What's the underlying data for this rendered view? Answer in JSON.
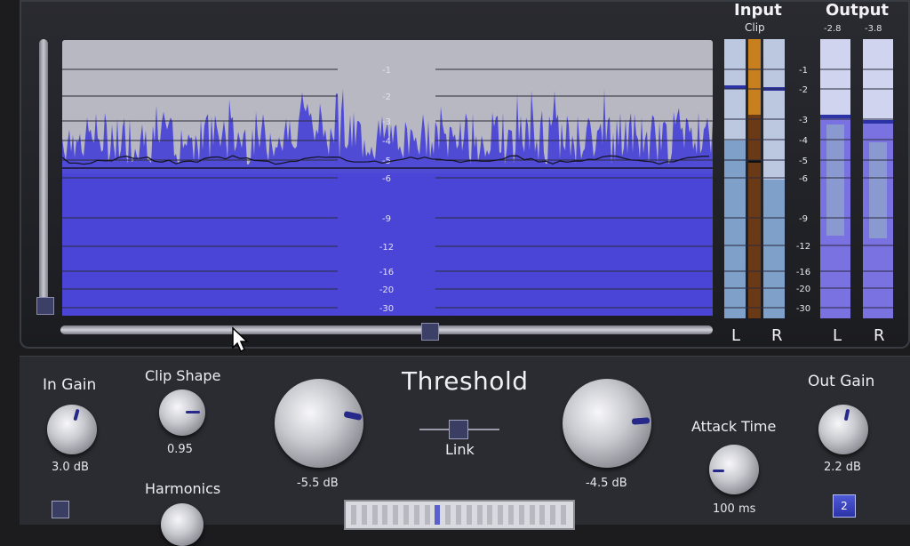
{
  "wave": {
    "scale_labels": [
      "-1",
      "-2",
      "-3",
      "-4",
      "-5",
      "-6",
      "-9",
      "-12",
      "-16",
      "-20",
      "-30"
    ]
  },
  "meters": {
    "input_title": "Input",
    "clip_label": "Clip",
    "output_title": "Output",
    "output_peak_l": "-2.8",
    "output_peak_r": "-3.8",
    "scale_labels": [
      "-1",
      "-2",
      "-3",
      "-4",
      "-5",
      "-6",
      "-9",
      "-12",
      "-16",
      "-20",
      "-30"
    ],
    "input_l": "L",
    "input_r": "R",
    "output_l": "L",
    "output_r": "R"
  },
  "controls": {
    "in_gain_label": "In Gain",
    "in_gain_value": "3.0 dB",
    "clip_shape_label": "Clip Shape",
    "clip_shape_value": "0.95",
    "harmonics_label": "Harmonics",
    "threshold_title": "Threshold",
    "threshold_left_value": "-5.5 dB",
    "threshold_right_value": "-4.5 dB",
    "link_label": "Link",
    "attack_label": "Attack Time",
    "attack_value": "100 ms",
    "out_gain_label": "Out Gain",
    "out_gain_value": "2.2 dB",
    "mode_button": "2"
  },
  "colors": {
    "waveform": "#4a45d6",
    "waveform_bg": "#b8b8c2",
    "clip_meter": "#c8801f",
    "accent": "#2b33a6"
  }
}
